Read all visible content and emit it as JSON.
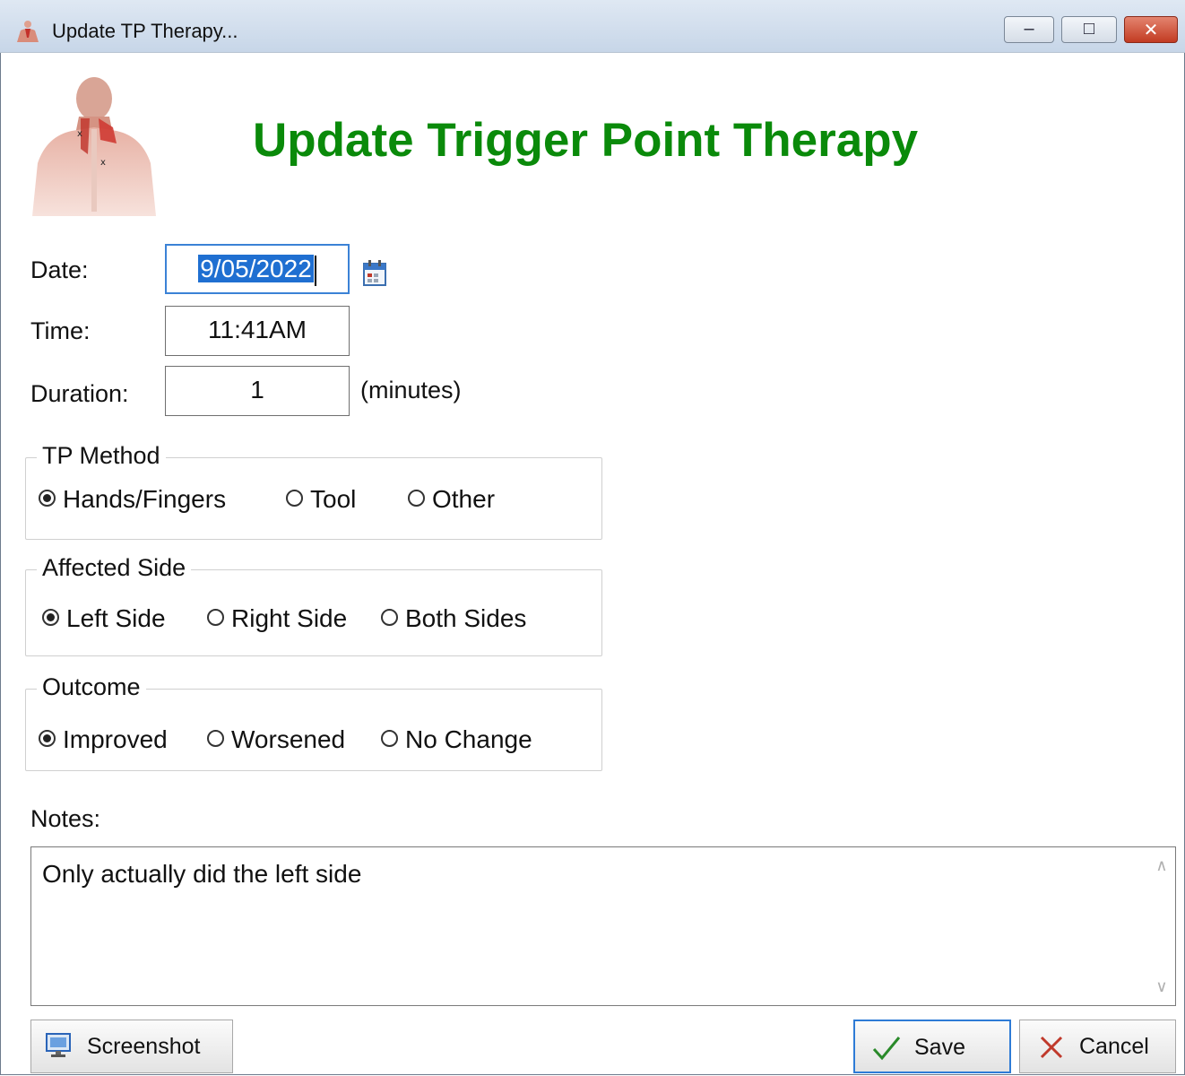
{
  "window": {
    "title": "Update TP Therapy...",
    "controls": {
      "minimize": "minimize",
      "maximize": "maximize",
      "close": "close"
    }
  },
  "header": {
    "title": "Update Trigger Point Therapy"
  },
  "form": {
    "date_label": "Date:",
    "date_value": "9/05/2022",
    "time_label": "Time:",
    "time_value": "11:41AM",
    "duration_label": "Duration:",
    "duration_value": "1",
    "duration_unit": "(minutes)"
  },
  "tp_method": {
    "title": "TP Method",
    "options": [
      "Hands/Fingers",
      "Tool",
      "Other"
    ],
    "selected": "Hands/Fingers"
  },
  "affected_side": {
    "title": "Affected Side",
    "options": [
      "Left Side",
      "Right Side",
      "Both Sides"
    ],
    "selected": "Left Side"
  },
  "outcome": {
    "title": "Outcome",
    "options": [
      "Improved",
      "Worsened",
      "No Change"
    ],
    "selected": "Improved"
  },
  "notes": {
    "label": "Notes:",
    "value": "Only actually did the left side"
  },
  "buttons": {
    "screenshot": "Screenshot",
    "save": "Save",
    "cancel": "Cancel"
  },
  "colors": {
    "title_green": "#0a8a0a",
    "focus_blue": "#3b82d6",
    "selection_blue": "#1f6fd1"
  },
  "icons": {
    "app": "body-figure-icon",
    "calendar": "calendar-icon",
    "screenshot": "monitor-icon",
    "save": "checkmark-icon",
    "cancel": "x-icon"
  }
}
